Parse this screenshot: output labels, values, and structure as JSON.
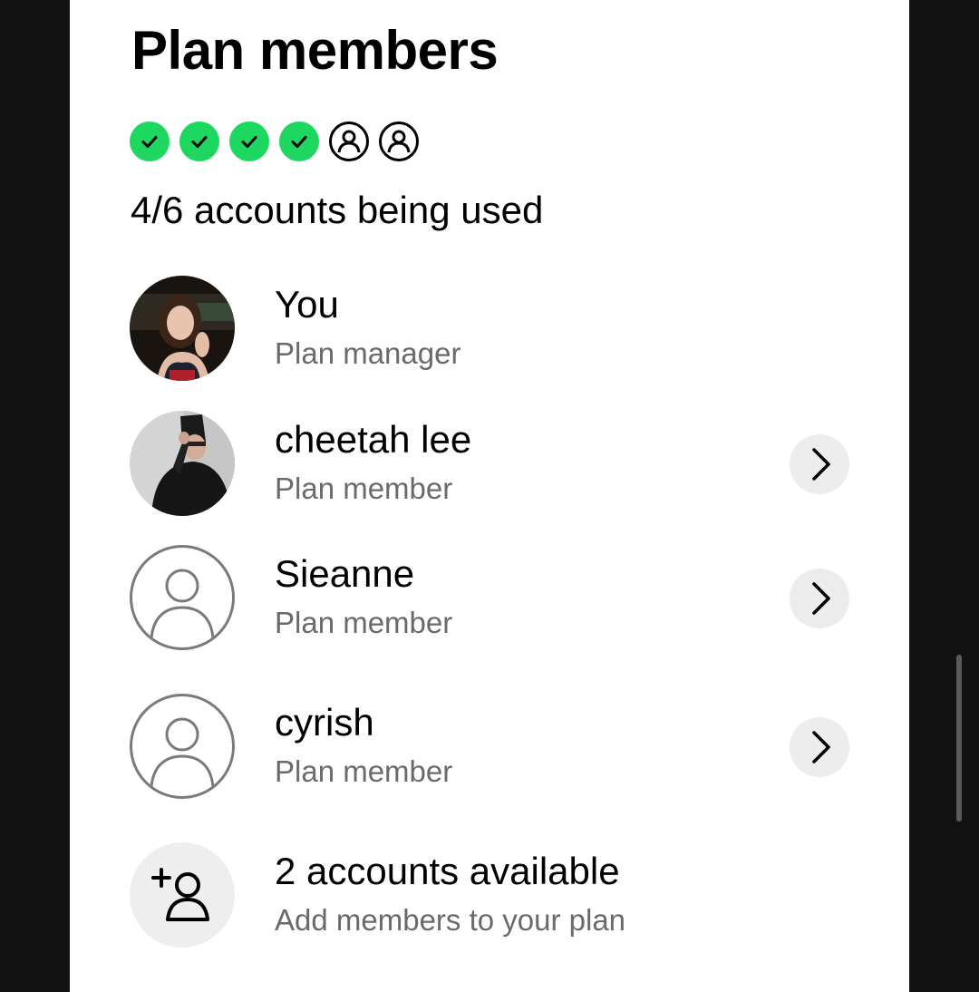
{
  "header": {
    "title": "Plan members"
  },
  "slots": {
    "used": 4,
    "total": 6,
    "used_color": "#1ed760"
  },
  "usage_text": "4/6 accounts being used",
  "members": [
    {
      "name": "You",
      "role": "Plan manager",
      "avatar": "photo-woman",
      "has_chevron": false
    },
    {
      "name": "cheetah lee",
      "role": "Plan member",
      "avatar": "photo-man",
      "has_chevron": true
    },
    {
      "name": "Sieanne",
      "role": "Plan member",
      "avatar": "user-placeholder-icon",
      "has_chevron": true
    },
    {
      "name": "cyrish",
      "role": "Plan member",
      "avatar": "user-placeholder-icon",
      "has_chevron": true
    }
  ],
  "add_member": {
    "title": "2 accounts available",
    "subtitle": "Add members to your plan",
    "icon": "add-user-icon"
  }
}
